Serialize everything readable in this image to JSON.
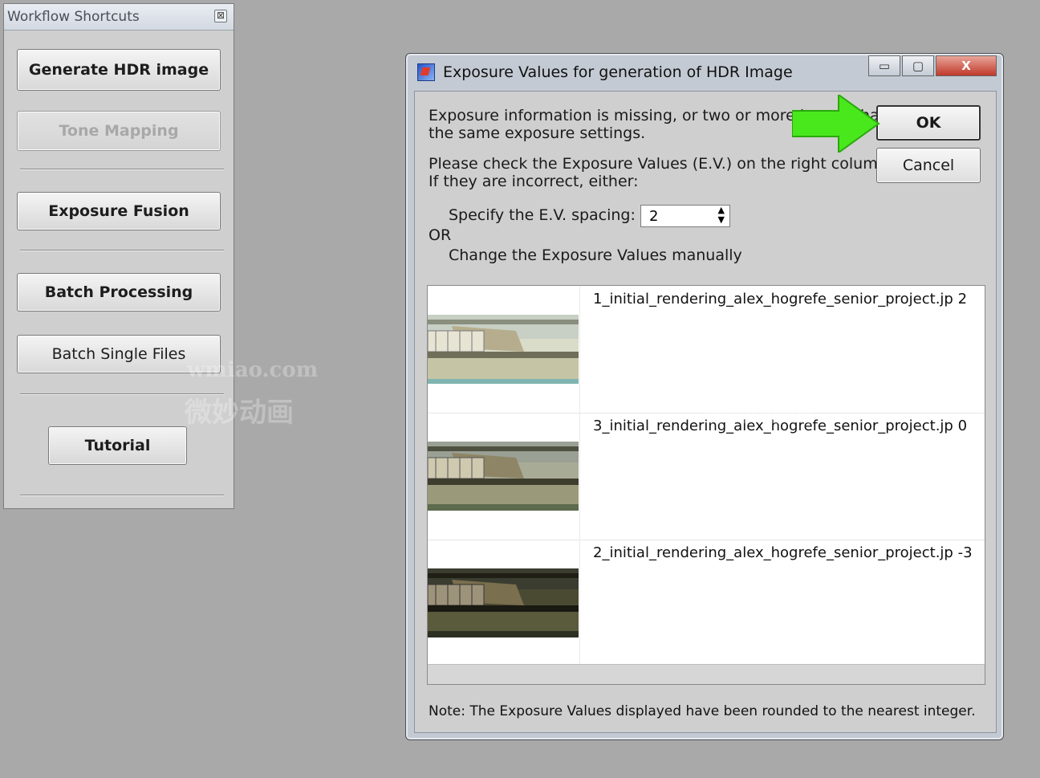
{
  "workflow_panel": {
    "title": "Workflow Shortcuts",
    "close_glyph": "⊠",
    "buttons": [
      {
        "label": "Generate HDR image",
        "enabled": true
      },
      {
        "label": "Tone Mapping",
        "enabled": false
      },
      {
        "label": "Exposure Fusion",
        "enabled": true
      },
      {
        "label": "Batch Processing",
        "enabled": true
      },
      {
        "label": "Batch Single Files",
        "enabled": true
      },
      {
        "label": "Tutorial",
        "enabled": true
      }
    ]
  },
  "dialog": {
    "title": "Exposure Values for generation of HDR Image",
    "caption_buttons": {
      "minimize": "▭",
      "maximize": "▢",
      "close": "X"
    },
    "message_line1": "Exposure information is missing, or two or more images have",
    "message_line2": "the same exposure settings.",
    "check_line1": "Please check the Exposure Values (E.V.) on the right column.",
    "check_line2": "If they are incorrect, either:",
    "spacing_label": "Specify the E.V. spacing:",
    "spacing_value": "2",
    "or_label": "OR",
    "manual_label": "Change the Exposure Values manually",
    "ok_label": "OK",
    "cancel_label": "Cancel",
    "images": [
      {
        "label": "1_initial_rendering_alex_hogrefe_senior_project.jp 2",
        "brightness": "bright"
      },
      {
        "label": "3_initial_rendering_alex_hogrefe_senior_project.jp 0",
        "brightness": "normal"
      },
      {
        "label": "2_initial_rendering_alex_hogrefe_senior_project.jp -3",
        "brightness": "dark"
      }
    ],
    "note": "Note: The Exposure Values displayed have been rounded to the nearest integer."
  },
  "annotation": {
    "arrow_color": "#49e81d",
    "points_to": "OK"
  },
  "watermark": {
    "text_latin": "wmiao.com",
    "text_cjk": "微妙动画"
  }
}
